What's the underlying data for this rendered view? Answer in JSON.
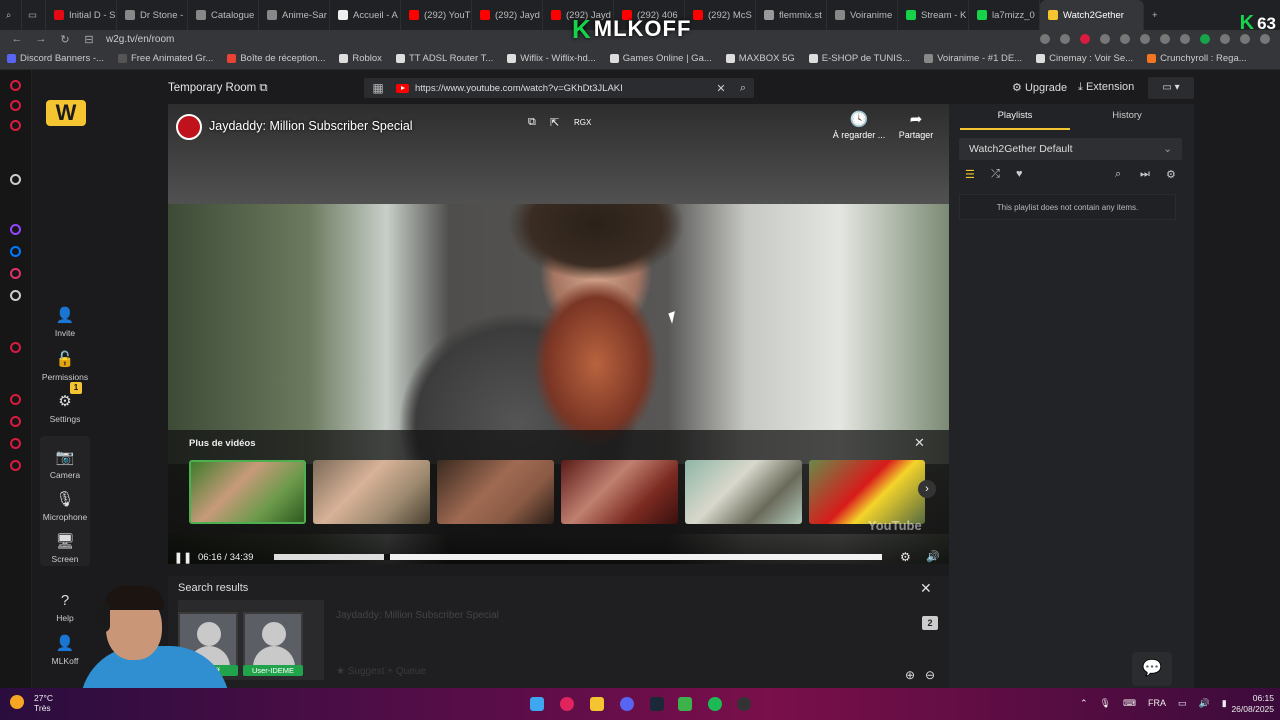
{
  "browser": {
    "tabs": [
      {
        "label": "Initial D - S",
        "color": "#e50914"
      },
      {
        "label": "Dr Stone -",
        "color": "#888888"
      },
      {
        "label": "Catalogue",
        "color": "#888888"
      },
      {
        "label": "Anime-Sar",
        "color": "#888888"
      },
      {
        "label": "Accueil - A",
        "color": "#eeeeee"
      },
      {
        "label": "(292) YouT",
        "color": "#ff0000"
      },
      {
        "label": "(292) Jayd",
        "color": "#ff0000"
      },
      {
        "label": "(292) Jayd",
        "color": "#ff0000"
      },
      {
        "label": "(292) 406",
        "color": "#ff0000"
      },
      {
        "label": "(292) McS",
        "color": "#ff0000"
      },
      {
        "label": "flemmix.st",
        "color": "#999999"
      },
      {
        "label": "Voiranime",
        "color": "#888888"
      },
      {
        "label": "Stream - K",
        "color": "#16d34a"
      },
      {
        "label": "la7mizz_0",
        "color": "#16d34a"
      }
    ],
    "active_tab": "Watch2Gether",
    "address": "w2g.tv/en/room",
    "bookmarks": [
      {
        "label": "Discord Banners -...",
        "color": "#5865f2"
      },
      {
        "label": "Free Animated Gr...",
        "color": "#555555"
      },
      {
        "label": "Boîte de réception...",
        "color": "#ea4335"
      },
      {
        "label": "Roblox",
        "color": "#dddddd"
      },
      {
        "label": "TT ADSL Router T...",
        "color": "#dddddd"
      },
      {
        "label": "Wiflix - Wiflix-hd...",
        "color": "#dddddd"
      },
      {
        "label": "Games Online | Ga...",
        "color": "#dddddd"
      },
      {
        "label": "MAXBOX 5G",
        "color": "#dddddd"
      },
      {
        "label": "E-SHOP de TUNIS...",
        "color": "#dddddd"
      },
      {
        "label": "Voiranime - #1 DE...",
        "color": "#888888"
      },
      {
        "label": "Cinemay : Voir Se...",
        "color": "#dddddd"
      },
      {
        "label": "Crunchyroll : Rega...",
        "color": "#f47521"
      }
    ]
  },
  "overlay": {
    "brand_k": "K",
    "brand_text": "MLKOFF",
    "viewers": "63",
    "viewers_k": "K"
  },
  "app": {
    "logo": "W",
    "room_title": "Temporary Room",
    "url": "https://www.youtube.com/watch?v=GKhDt3JLAKI",
    "upgrade": "Upgrade",
    "extension": "Extension",
    "nav": {
      "invite": "Invite",
      "permissions": "Permissions",
      "settings": "Settings",
      "settings_badge": "1",
      "camera": "Camera",
      "microphone": "Microphone",
      "screen": "Screen",
      "help": "Help",
      "user": "MLKoff"
    }
  },
  "video": {
    "title": "Jaydaddy: Million Subscriber Special",
    "watch_later": "À regarder ...",
    "share": "Partager",
    "more_videos": "Plus de vidéos",
    "watermark": "YouTube",
    "time": "06:16 / 34:39",
    "progress": 0.181
  },
  "search": {
    "header": "Search results",
    "result_title": "Jaydaddy: Million Subscriber Special",
    "result_count": "2",
    "actions": "★ Suggest   + Queue"
  },
  "users": [
    {
      "name": "MLKoff"
    },
    {
      "name": "User-IDEME"
    }
  ],
  "playlist": {
    "tab_playlists": "Playlists",
    "tab_history": "History",
    "selected": "Watch2Gether Default",
    "empty": "This playlist does not contain any items."
  },
  "taskbar": {
    "temp": "27°C",
    "weather": "Très",
    "lang": "FRA",
    "time": "06:15",
    "date": "26/08/2025"
  }
}
